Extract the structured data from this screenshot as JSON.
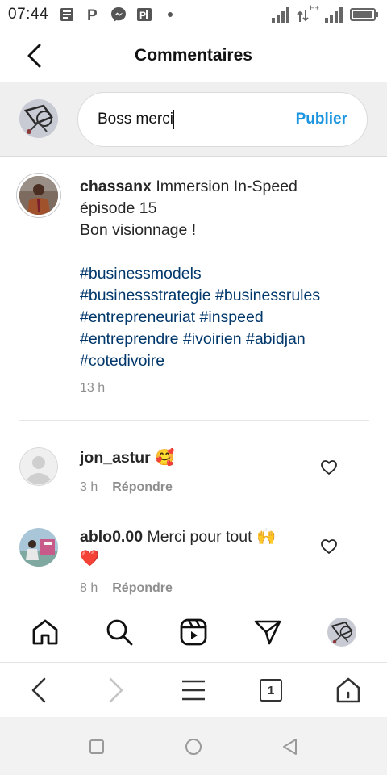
{
  "status_bar": {
    "time": "07:44",
    "icons": [
      "news-icon",
      "parking-p-icon",
      "messenger-icon",
      "pdf-icon",
      "dot-icon"
    ],
    "right_icons": [
      "signal-icon",
      "data-hplus-icon",
      "signal-icon-2",
      "battery-icon"
    ],
    "network_label": "H+"
  },
  "header": {
    "title": "Commentaires",
    "back_icon": "chevron-left-icon"
  },
  "composer": {
    "value": "Boss merci",
    "publish_label": "Publier",
    "accent": "#1b95e0"
  },
  "caption": {
    "username": "chassanx",
    "line1": "Immersion In-Speed",
    "line2": "épisode 15",
    "line3": "Bon visionnage !",
    "hashtags_lines": [
      [
        "#businessmodels"
      ],
      [
        "#businessstrategie",
        "#businessrules"
      ],
      [
        "#entrepreneuriat",
        "#inspeed"
      ],
      [
        "#entreprendre",
        "#ivoirien",
        "#abidjan"
      ],
      [
        "#cotedivoire"
      ]
    ],
    "time": "13 h",
    "hashtag_color": "#00376b"
  },
  "comments": [
    {
      "username": "jon_astur",
      "text": "🥰",
      "time": "3 h",
      "reply_label": "Répondre"
    },
    {
      "username": "ablo0.00",
      "text": "Merci pour tout 🙌",
      "text2": "❤️",
      "time": "8 h",
      "reply_label": "Répondre"
    }
  ],
  "ig_nav": [
    "home-icon",
    "search-icon",
    "reels-icon",
    "direct-send-icon",
    "profile-avatar"
  ],
  "browser_bar": {
    "tab_count": "1",
    "icons": [
      "back-icon",
      "forward-icon",
      "menu-icon",
      "tabs-icon",
      "home-icon"
    ]
  },
  "system_nav": [
    "recents-square-icon",
    "home-circle-icon",
    "back-triangle-icon"
  ]
}
